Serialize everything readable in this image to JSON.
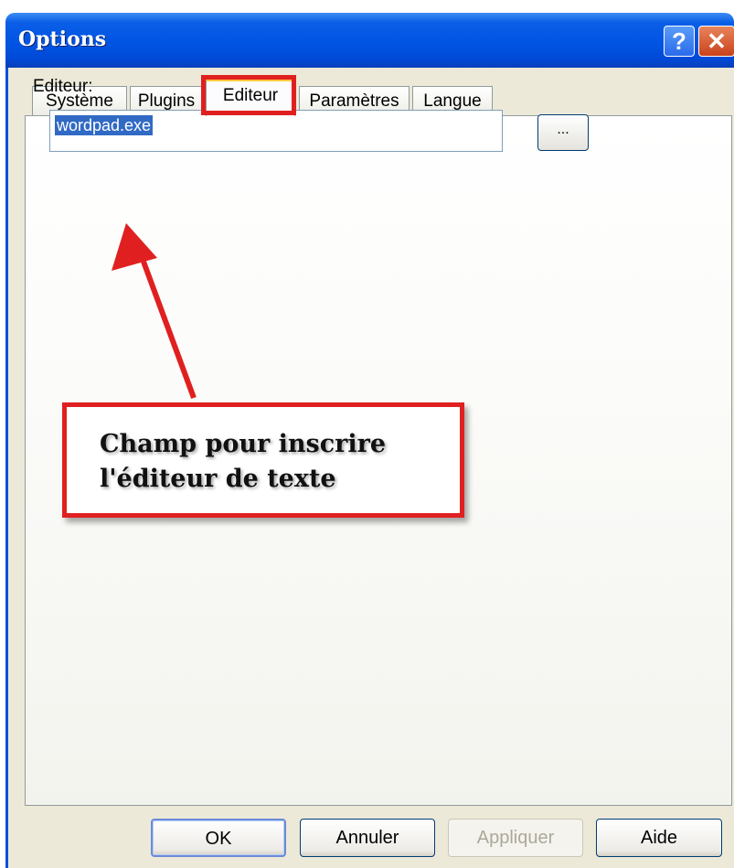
{
  "window": {
    "title": "Options",
    "help_label": "?",
    "close_label": "✕"
  },
  "tabs": [
    {
      "label": "Système",
      "active": false
    },
    {
      "label": "Plugins",
      "active": false
    },
    {
      "label": "Editeur",
      "active": true
    },
    {
      "label": "Paramètres",
      "active": false
    },
    {
      "label": "Langue",
      "active": false
    }
  ],
  "editor": {
    "label": "Editeur:",
    "value": "wordpad.exe",
    "browse_label": "..."
  },
  "annotation": {
    "line1": "Champ pour inscrire",
    "line2": "l'éditeur de texte",
    "color": "#e02020"
  },
  "buttons": {
    "ok": "OK",
    "cancel": "Annuler",
    "apply": "Appliquer",
    "help": "Aide"
  },
  "colors": {
    "titlebar": "#0054e3",
    "dialog_bg": "#ece9d8",
    "selection": "#316ac5"
  }
}
